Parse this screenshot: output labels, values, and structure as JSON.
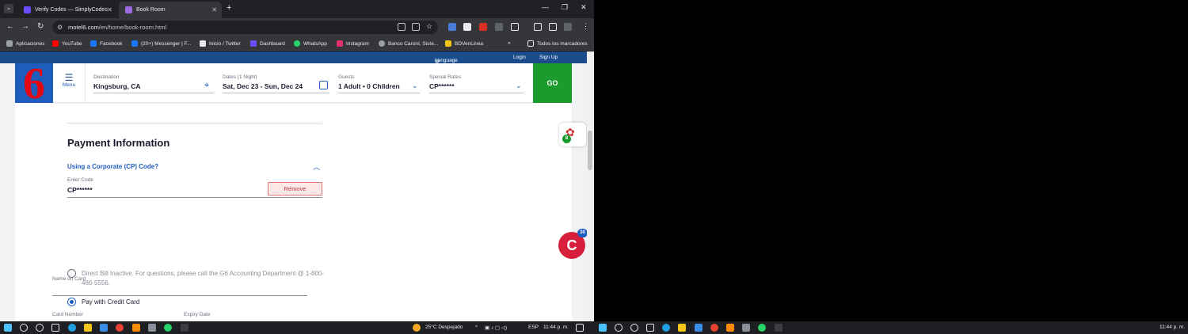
{
  "browser": {
    "tabs": [
      {
        "title": "Verify Codes — SimplyCodes",
        "active": false
      },
      {
        "title": "Book Room",
        "active": true
      }
    ],
    "url_host": "motel6.com",
    "url_path": "/en/home/book-room.html",
    "bookmarks": [
      {
        "label": "Aplicaciones",
        "color": "#9aa0a6"
      },
      {
        "label": "YouTube",
        "color": "#ff0000"
      },
      {
        "label": "Facebook",
        "color": "#1877f2"
      },
      {
        "label": "(20+) Messenger | F...",
        "color": "#1877f2"
      },
      {
        "label": "Inicio / Twitter",
        "color": "#e8eaed"
      },
      {
        "label": "Dashboard",
        "color": "#6a4cff"
      },
      {
        "label": "WhatsApp",
        "color": "#25d366"
      },
      {
        "label": "Instagram",
        "color": "#e1306c"
      },
      {
        "label": "Banco Caroní, Siste...",
        "color": "#9aa0a6"
      },
      {
        "label": "BDVenLinea",
        "color": "#f5c518"
      }
    ],
    "all_bookmarks_label": "Todos los marcadores"
  },
  "site": {
    "language_label": "Language EN",
    "login_label": "Login",
    "signup_label": "Sign Up",
    "logo_text": "6",
    "menu_label": "Menu",
    "search": {
      "destination_label": "Destination",
      "destination_value": "Kingsburg, CA",
      "dates_label": "Dates (1 Night)",
      "dates_value": "Sat, Dec 23 - Sun, Dec 24",
      "guests_label": "Guests",
      "guests_value": "1 Adult • 0 Children",
      "rates_label": "Special Rates",
      "rates_value": "CP******",
      "go_label": "GO"
    }
  },
  "payment": {
    "title": "Payment Information",
    "cp_toggle": "Using a Corporate (CP) Code?",
    "code_label": "Enter Code",
    "code_value": "CP******",
    "remove_label": "Remove",
    "option_direct_bill": "Direct Bill Inactive. For questions, please call the G6 Accounting Department @ 1-800-466-5556.",
    "option_credit_card": "Pay with Credit Card",
    "name_label": "Name on Card",
    "card_number_label": "Card Number",
    "expiry_label": "Expiry Date"
  },
  "widgets": {
    "gift_badge": "8",
    "chat_badge": "30"
  },
  "taskbar_left": {
    "weather": "25°C  Despejado",
    "lang": "ESP",
    "time": "11:44 p. m."
  },
  "taskbar_right": {
    "time": "11:44 p. m."
  }
}
